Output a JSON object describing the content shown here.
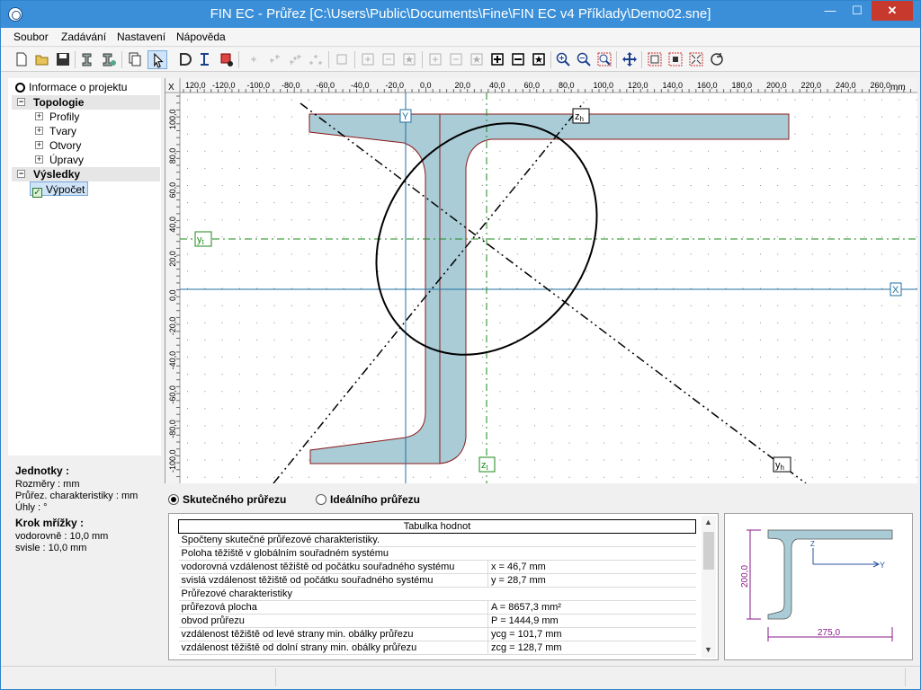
{
  "window": {
    "title": "FIN EC - Průřez [C:\\Users\\Public\\Documents\\Fine\\FIN EC v4 Příklady\\Demo02.sne]",
    "minimize": "—",
    "maximize": "☐",
    "close": "✕"
  },
  "menu": [
    "Soubor",
    "Zadávání",
    "Nastavení",
    "Nápověda"
  ],
  "toolbar": {
    "icons": [
      "new-file-icon",
      "open-folder-icon",
      "save-icon",
      "profile-icon",
      "profile-edit-icon",
      "copy-icon",
      "select-arrow-icon",
      "draw-icon",
      "i-beam-icon",
      "section-red-icon",
      "point-icon",
      "point2-icon",
      "point3-icon",
      "point4-icon",
      "node-icon",
      "add-rect-icon",
      "sub-rect-icon",
      "star-rect-icon",
      "add-shape-icon",
      "sub-shape-icon",
      "shape-bold-icon",
      "shape-sub-bold-icon",
      "shape-star-icon",
      "zoom-in-icon",
      "zoom-out-icon",
      "zoom-window-icon",
      "pan-icon",
      "zoom-rect-icon",
      "zoom-all-icon",
      "zoom-fit-icon",
      "refresh-icon"
    ]
  },
  "tree": {
    "project_info": "Informace o projektu",
    "topology": "Topologie",
    "topology_items": [
      "Profily",
      "Tvary",
      "Otvory",
      "Úpravy"
    ],
    "results": "Výsledky",
    "results_items": [
      "Výpočet"
    ]
  },
  "units": {
    "title": "Jednotky :",
    "dimensions": "Rozměry : mm",
    "section_char": "Průřez. charakteristiky : mm",
    "angles": "Úhly : °",
    "grid_title": "Krok mřížky :",
    "grid_h": "vodorovně : 10,0 mm",
    "grid_v": "svisle : 10,0 mm"
  },
  "canvas": {
    "ruler_unit": "mm",
    "x_ticks": [
      "-120,0",
      "-100,0",
      "-80,0",
      "-60,0",
      "-40,0",
      "-20,0",
      "0,0",
      "20,0",
      "40,0",
      "60,0",
      "80,0",
      "100,0",
      "120,0",
      "140,0",
      "160,0",
      "180,0",
      "200,0",
      "220,0",
      "240,0",
      "260,0"
    ],
    "x_tick_first": "120,0",
    "y_ticks": [
      "100,0",
      "80,0",
      "60,0",
      "40,0",
      "20,0",
      "0,0",
      "-20,0",
      "-40,0",
      "-60,0",
      "-80,0",
      "-100,0"
    ],
    "labels": {
      "Y": "Y",
      "X": "X",
      "zh": "z",
      "zh_sub": "h",
      "yt": "y",
      "yt_sub": "t",
      "zt": "z",
      "zt_sub": "t",
      "yh": "y",
      "yh_sub": "h"
    },
    "colors": {
      "section_fill": "#a9ccd6",
      "section_stroke": "#8b1a1a",
      "axis_blue": "#1f6fa0",
      "centroid_green": "#1a8a1a"
    }
  },
  "radios": {
    "real": "Skutečného průřezu",
    "ideal": "Ideálního průřezu",
    "selected": "real"
  },
  "table": {
    "header": "Tabulka hodnot",
    "rows": [
      {
        "type": "full",
        "text": "Spočteny skutečné průřezové charakteristiky."
      },
      {
        "type": "full",
        "text": "Poloha těžiště v globálním souřadném systému"
      },
      {
        "type": "row",
        "label": "vodorovná vzdálenost těžiště od počátku souřadného systému",
        "value": "x = 46,7 mm"
      },
      {
        "type": "row",
        "label": "svislá vzdálenost těžiště od počátku souřadného systému",
        "value": "y = 28,7 mm"
      },
      {
        "type": "full",
        "text": "Průřezové charakteristiky"
      },
      {
        "type": "row",
        "label": "průřezová plocha",
        "value": "A = 8657,3 mm²"
      },
      {
        "type": "row",
        "label": "obvod průřezu",
        "value": "P = 1444,9 mm"
      },
      {
        "type": "row",
        "label": "vzdálenost těžiště od levé strany min. obálky průřezu",
        "value": "ycg = 101,7 mm"
      },
      {
        "type": "row",
        "label": "vzdálenost těžiště od dolní strany min. obálky průřezu",
        "value": "zcg = 128,7 mm"
      }
    ]
  },
  "thumbnail": {
    "height_label": "200,0",
    "width_label": "275,0",
    "axis_y": "Y",
    "axis_z": "Z"
  }
}
